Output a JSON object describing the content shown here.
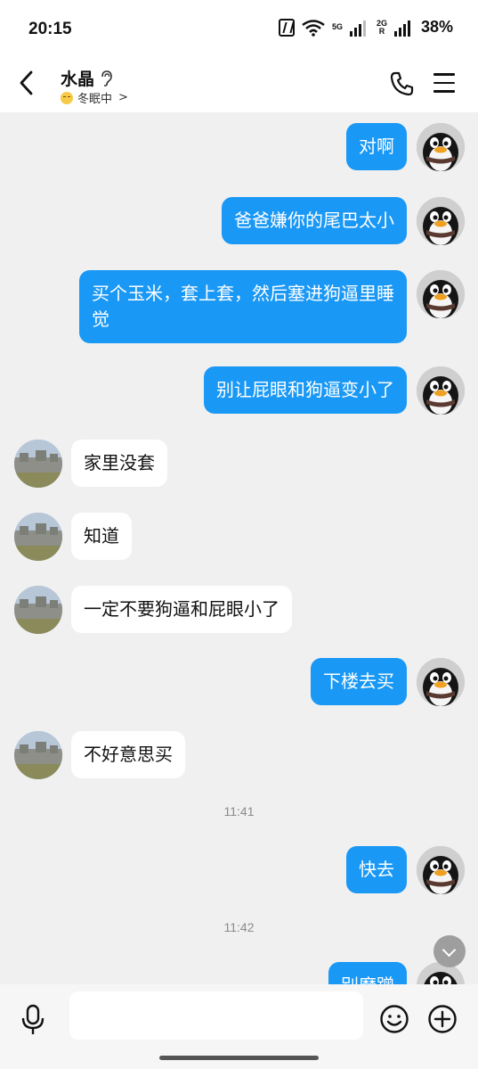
{
  "status_bar": {
    "time": "20:15",
    "network_1": "5G",
    "network_2_top": "2G",
    "network_2_bottom": "R",
    "battery": "38%"
  },
  "header": {
    "contact_name": "水晶",
    "status_text": "冬眠中",
    "status_chevron": ">"
  },
  "colors": {
    "outgoing_bubble": "#1a98f5",
    "incoming_bubble": "#ffffff",
    "chat_background": "#f0f0f0"
  },
  "messages": [
    {
      "from": "me",
      "text": "对啊"
    },
    {
      "from": "me",
      "text": "爸爸嫌你的尾巴太小"
    },
    {
      "from": "me",
      "text": "买个玉米，套上套，然后塞进狗逼里睡觉"
    },
    {
      "from": "me",
      "text": "别让屁眼和狗逼变小了"
    },
    {
      "from": "them",
      "text": "家里没套"
    },
    {
      "from": "them",
      "text": "知道"
    },
    {
      "from": "them",
      "text": "一定不要狗逼和屁眼小了"
    },
    {
      "from": "me",
      "text": "下楼去买"
    },
    {
      "from": "them",
      "text": "不好意思买"
    },
    {
      "type": "timestamp",
      "text": "11:41"
    },
    {
      "from": "me",
      "text": "快去"
    },
    {
      "type": "timestamp",
      "text": "11:42"
    },
    {
      "from": "me",
      "text": "别磨蹭",
      "partially_visible": true
    }
  ],
  "input": {
    "placeholder": ""
  }
}
